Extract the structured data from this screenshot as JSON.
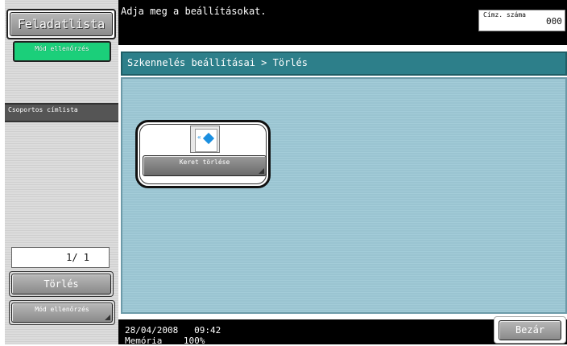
{
  "sidebar": {
    "task_list_label": "Feladatlista",
    "mode_check_top_label": "Mód ellenőrzés",
    "group_addressbook_label": "Csoportos címlista",
    "page_indicator": "1/  1",
    "delete_label": "Törlés",
    "mode_check_bottom_label": "Mód ellenőrzés"
  },
  "header": {
    "message": "Adja meg a beállításokat.",
    "address_count_label": "Címz. száma",
    "address_count": "000"
  },
  "main": {
    "breadcrumb": "Szkennelés beállításai > Törlés",
    "functions": [
      {
        "label": "Keret törlése",
        "icon": "frame-erase-icon"
      }
    ]
  },
  "footer": {
    "date": "28/04/2008",
    "time": "09:42",
    "memory_label": "Memória",
    "memory_value": "100%",
    "close_label": "Bezár"
  },
  "colors": {
    "accent": "#1bcf7a",
    "breadcrumb_bar": "#2d7f8a",
    "content_bg": "#9dc7d4"
  }
}
